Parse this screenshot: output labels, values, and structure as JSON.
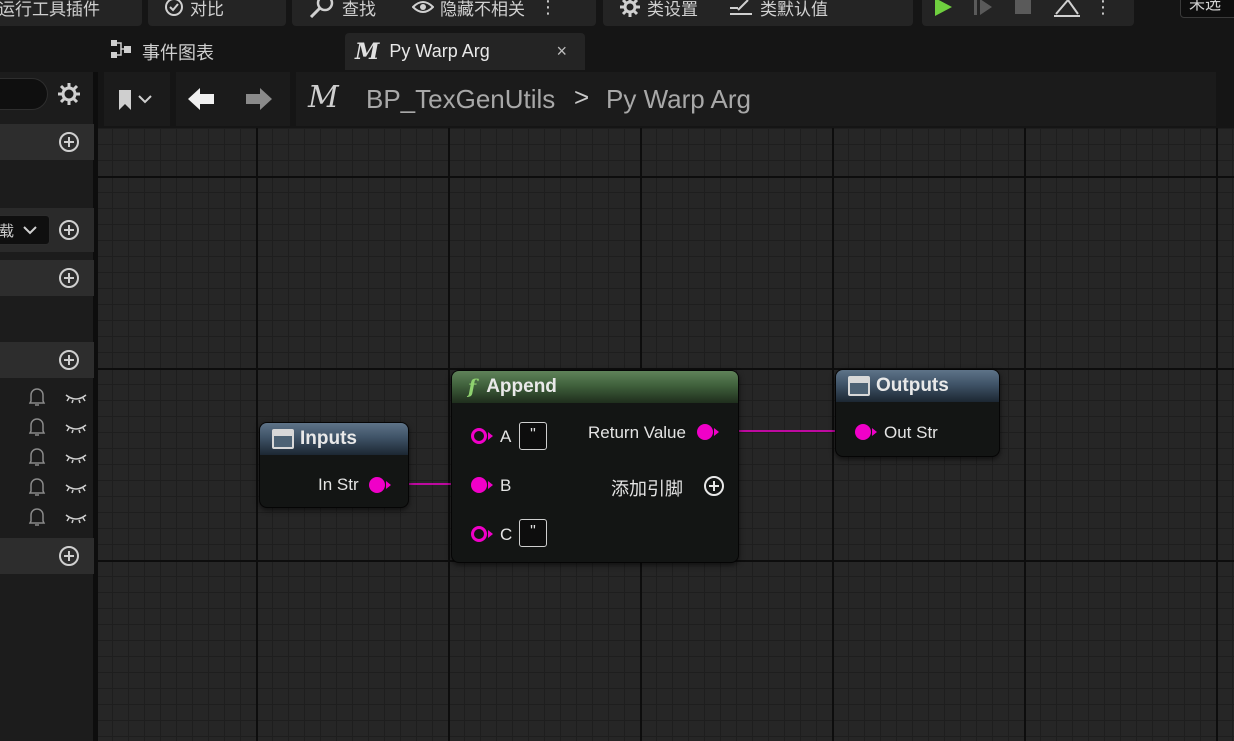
{
  "toolbar": {
    "tools_label": "运行工具插件",
    "diff_label": "对比",
    "find_label": "查找",
    "hide_label": "隐藏不相关",
    "class_settings_label": "类设置",
    "class_defaults_label": "类默认值",
    "debug_label": "未选"
  },
  "tabs": [
    {
      "label": "事件图表",
      "icon": "graph-icon"
    },
    {
      "label": "Py Warp Arg",
      "icon": "function-m-icon",
      "close": "×"
    }
  ],
  "breadcrumb": {
    "blueprint": "BP_TexGenUtils",
    "separator": ">",
    "function": "Py Warp Arg"
  },
  "left_panel": {
    "dropdown_text": "载"
  },
  "nodes": {
    "inputs": {
      "title": "Inputs",
      "pins": [
        {
          "label": "In Str"
        }
      ]
    },
    "append": {
      "title": "Append",
      "icon": "function-f-icon",
      "inputs": [
        {
          "label": "A",
          "default": "\""
        },
        {
          "label": "B"
        },
        {
          "label": "C",
          "default": "\""
        }
      ],
      "outputs": [
        {
          "label": "Return Value"
        },
        {
          "label": "添加引脚"
        }
      ]
    },
    "outputs": {
      "title": "Outputs",
      "pins": [
        {
          "label": "Out Str"
        }
      ]
    }
  },
  "colors": {
    "string_pin": "#f000c8",
    "graph_bg": "#262626",
    "node_header_struct": "#3f5367",
    "node_header_function": "#40613c",
    "play_green": "#6fcf3f"
  }
}
